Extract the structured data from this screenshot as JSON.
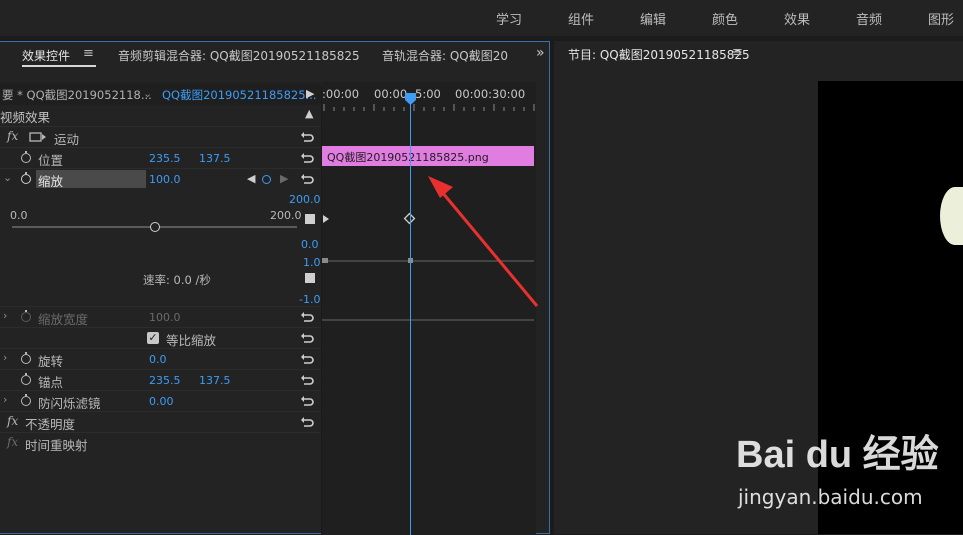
{
  "workspace_tabs": [
    "学习",
    "组件",
    "编辑",
    "颜色",
    "效果",
    "音频",
    "图形"
  ],
  "panel_tabs": {
    "effect_controls": "效果控件",
    "audio_clip_mixer": "音频剪辑混合器: QQ截图20190521185825",
    "audio_track_mixer": "音轨混合器: QQ截图20",
    "more": "»"
  },
  "program_monitor": {
    "title": "节目: QQ截图20190521185825",
    "menu": "≡"
  },
  "source_selector": {
    "master": "要 * QQ截图2019052118...",
    "sequence": "QQ截图20190521185825..."
  },
  "timecodes": {
    "start": ":00:00",
    "mid": "00:00",
    "mid_b": "5:00",
    "end": "00:00:30:00"
  },
  "clip_name": "QQ截图20190521185825.png",
  "section_video_effects": "视频效果",
  "motion": {
    "label": "运动",
    "position": {
      "label": "位置",
      "x": "235.5",
      "y": "137.5"
    },
    "scale": {
      "label": "缩放",
      "value": "100.0",
      "graph_max": "200.0",
      "graph_min": "0.0",
      "slider_min": "0.0",
      "slider_max": "200.0",
      "slider_value_fraction": 0.5,
      "velocity_label": "速率: 0.0 /秒",
      "vel_max": "1.0",
      "vel_min": "-1.0"
    },
    "scale_width": {
      "label": "缩放宽度",
      "value": "100.0"
    },
    "uniform_scale": {
      "label": "等比缩放",
      "checked": true
    },
    "rotation": {
      "label": "旋转",
      "value": "0.0"
    },
    "anchor": {
      "label": "锚点",
      "x": "235.5",
      "y": "137.5"
    },
    "anti_flicker": {
      "label": "防闪烁滤镜",
      "value": "0.00"
    }
  },
  "opacity": {
    "label": "不透明度"
  },
  "time_remap": {
    "label": "时间重映射"
  },
  "watermark": {
    "brand": "Bai du 经验",
    "url": "jingyan.baidu.com"
  },
  "colors": {
    "accent": "#3e9cf5",
    "clip": "#e17ce0",
    "arrow": "#e8312f",
    "panel": "#232323"
  }
}
